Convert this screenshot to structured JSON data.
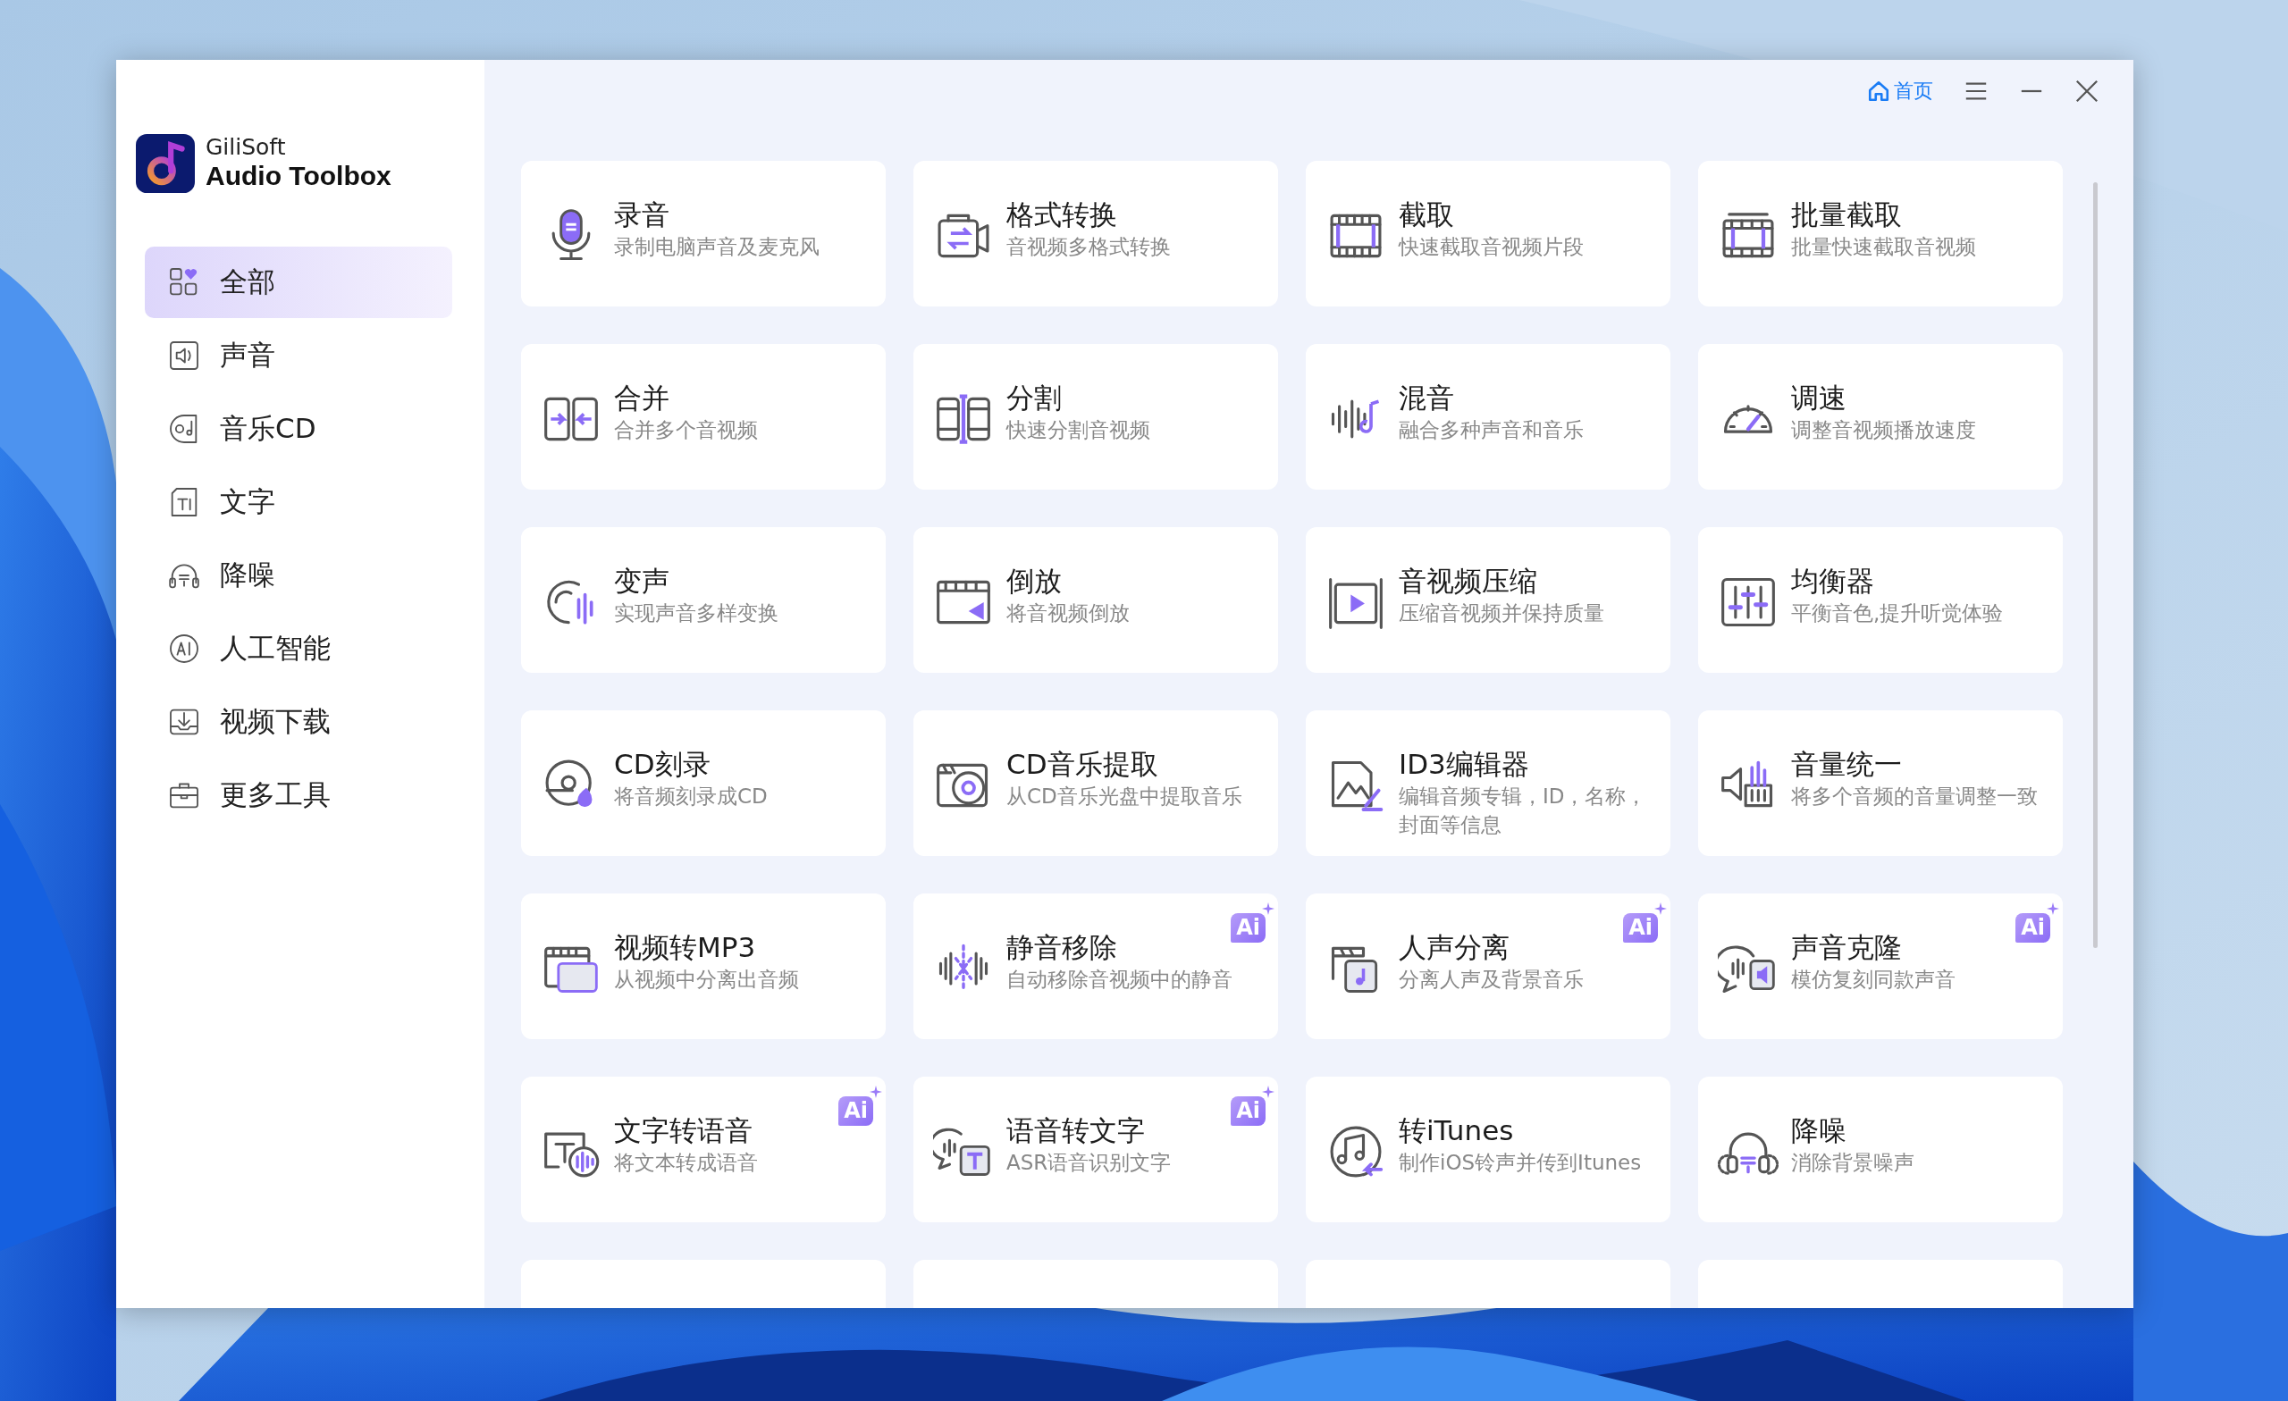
{
  "app": {
    "brand_small": "GiliSoft",
    "brand_name": "Audio Toolbox"
  },
  "sidebar": {
    "items": [
      {
        "label": "全部",
        "selected": true
      },
      {
        "label": "声音",
        "selected": false
      },
      {
        "label": "音乐CD",
        "selected": false
      },
      {
        "label": "文字",
        "selected": false
      },
      {
        "label": "降噪",
        "selected": false
      },
      {
        "label": "人工智能",
        "selected": false
      },
      {
        "label": "视频下载",
        "selected": false
      },
      {
        "label": "更多工具",
        "selected": false
      }
    ]
  },
  "top_bar": {
    "home_link": "首页"
  },
  "tools": [
    {
      "kind": "tool",
      "title": "录音",
      "subtitle": "录制电脑声音及麦克风"
    },
    {
      "kind": "tool",
      "title": "格式转换",
      "subtitle": "音视频多格式转换"
    },
    {
      "kind": "tool",
      "title": "截取",
      "subtitle": "快速截取音视频片段"
    },
    {
      "kind": "tool",
      "title": "批量截取",
      "subtitle": "批量快速截取音视频"
    },
    {
      "kind": "tool",
      "title": "合并",
      "subtitle": "合并多个音视频"
    },
    {
      "kind": "tool",
      "title": "分割",
      "subtitle": "快速分割音视频"
    },
    {
      "kind": "tool",
      "title": "混音",
      "subtitle": "融合多种声音和音乐"
    },
    {
      "kind": "tool",
      "title": "调速",
      "subtitle": "调整音视频播放速度"
    },
    {
      "kind": "tool",
      "title": "变声",
      "subtitle": "实现声音多样变换"
    },
    {
      "kind": "tool",
      "title": "倒放",
      "subtitle": "将音视频倒放"
    },
    {
      "kind": "tool",
      "title": "音视频压缩",
      "subtitle": "压缩音视频并保持质量"
    },
    {
      "kind": "tool",
      "title": "均衡器",
      "subtitle": "平衡音色,提升听觉体验"
    },
    {
      "kind": "tool",
      "title": "CD刻录",
      "subtitle": "将音频刻录成CD"
    },
    {
      "kind": "tool",
      "title": "CD音乐提取",
      "subtitle": "从CD音乐光盘中提取音乐"
    },
    {
      "kind": "tool",
      "title": "ID3编辑器",
      "subtitle": "编辑音频专辑，ID，名称，封面等信息"
    },
    {
      "kind": "tool",
      "title": "音量统一",
      "subtitle": "将多个音频的音量调整一致"
    },
    {
      "kind": "tool",
      "title": "视频转MP3",
      "subtitle": "从视频中分离出音频"
    },
    {
      "kind": "tool",
      "title": "静音移除",
      "subtitle": "自动移除音视频中的静音",
      "badge": "Ai"
    },
    {
      "kind": "tool",
      "title": "人声分离",
      "subtitle": "分离人声及背景音乐",
      "badge": "Ai"
    },
    {
      "kind": "tool",
      "title": "声音克隆",
      "subtitle": "模仿复刻同款声音",
      "badge": "Ai"
    },
    {
      "kind": "tool",
      "title": "文字转语音",
      "subtitle": "将文本转成语音",
      "badge": "Ai"
    },
    {
      "kind": "tool",
      "title": "语音转文字",
      "subtitle": "ASR语音识别文字",
      "badge": "Ai"
    },
    {
      "kind": "tool",
      "title": "转iTunes",
      "subtitle": "制作iOS铃声并传到Itunes"
    },
    {
      "kind": "tool",
      "title": "降噪",
      "subtitle": "消除背景噪声"
    },
    {
      "kind": "cut_off"
    },
    {
      "kind": "cut_off"
    },
    {
      "kind": "cut_off"
    },
    {
      "kind": "cut_off"
    }
  ]
}
